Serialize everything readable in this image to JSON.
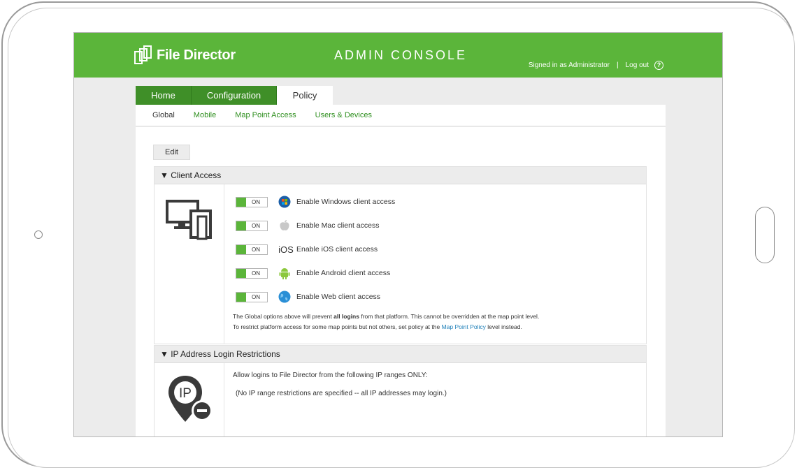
{
  "app": {
    "name": "File Director",
    "console_title": "ADMIN CONSOLE",
    "signed_in": "Signed in as Administrator",
    "separator": "|",
    "logout": "Log out",
    "help": "?"
  },
  "tabs": [
    {
      "label": "Home",
      "active": false
    },
    {
      "label": "Configuration",
      "active": false
    },
    {
      "label": "Policy",
      "active": true
    }
  ],
  "subnav": [
    {
      "label": "Global",
      "current": true
    },
    {
      "label": "Mobile",
      "current": false
    },
    {
      "label": "Map Point Access",
      "current": false
    },
    {
      "label": "Users & Devices",
      "current": false
    }
  ],
  "edit_label": "Edit",
  "client_access": {
    "title": "▼ Client Access",
    "toggles": [
      {
        "state": "ON",
        "icon": "windows-icon",
        "label": "Enable Windows client access"
      },
      {
        "state": "ON",
        "icon": "apple-icon",
        "label": "Enable Mac client access"
      },
      {
        "state": "ON",
        "icon": "ios-icon",
        "label": "Enable iOS client access"
      },
      {
        "state": "ON",
        "icon": "android-icon",
        "label": "Enable Android client access"
      },
      {
        "state": "ON",
        "icon": "web-globe-icon",
        "label": "Enable Web client access"
      }
    ],
    "note1_pre": "The Global options above will prevent ",
    "note1_bold": "all logins",
    "note1_post": " from that platform. This cannot be overridden at the map point level.",
    "note2_pre": "To restrict platform access for some map points but not others, set policy at the ",
    "note2_link": "Map Point Policy",
    "note2_post": " level instead."
  },
  "ip_restrictions": {
    "title": "▼ IP Address Login Restrictions",
    "icon_text": "IP",
    "line1": "Allow logins to File Director from the following IP ranges ONLY:",
    "line2": "(No IP range restrictions are specified -- all IP addresses may login.)"
  },
  "colors": {
    "brand_green": "#5bb53a",
    "tab_dark_green": "#3f8f28",
    "link_blue": "#1e7fb8"
  }
}
